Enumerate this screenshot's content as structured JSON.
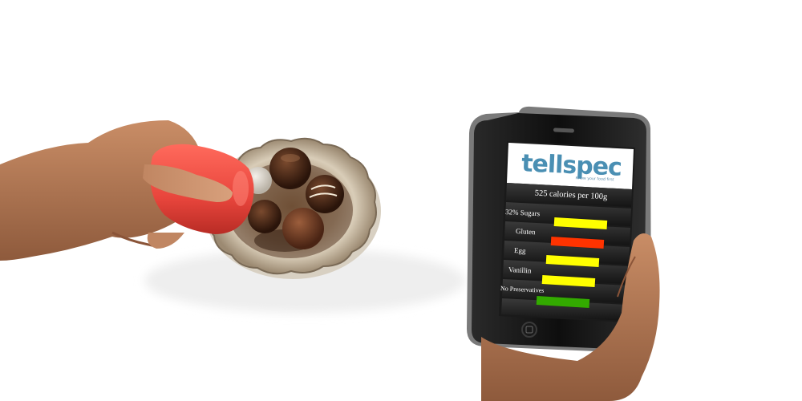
{
  "app": {
    "logo_text": "tellspec",
    "logo_tagline": "Know your food first"
  },
  "scan_result": {
    "calories_text": "525 calories per 100g",
    "ingredients": [
      {
        "label": "32% Sugars",
        "level": 0.85,
        "color": "#ffff00",
        "status": "yellow"
      },
      {
        "label": "Gluten",
        "level": 0.85,
        "color": "#ff3300",
        "status": "red"
      },
      {
        "label": "Egg",
        "level": 0.85,
        "color": "#ffff00",
        "status": "yellow"
      },
      {
        "label": "Vanillin",
        "level": 0.85,
        "color": "#ffff00",
        "status": "yellow"
      },
      {
        "label": "No Preservatives",
        "level": 0.85,
        "color": "#33aa00",
        "status": "green"
      }
    ]
  },
  "colors": {
    "brand": "#4a8fb3",
    "scanner": "#e8453c",
    "warning": "#ffff00",
    "danger": "#ff3300",
    "safe": "#33aa00"
  },
  "icons": [
    "hand",
    "scanner",
    "chocolate-truffle",
    "silver-plate",
    "phone",
    "home-button"
  ]
}
